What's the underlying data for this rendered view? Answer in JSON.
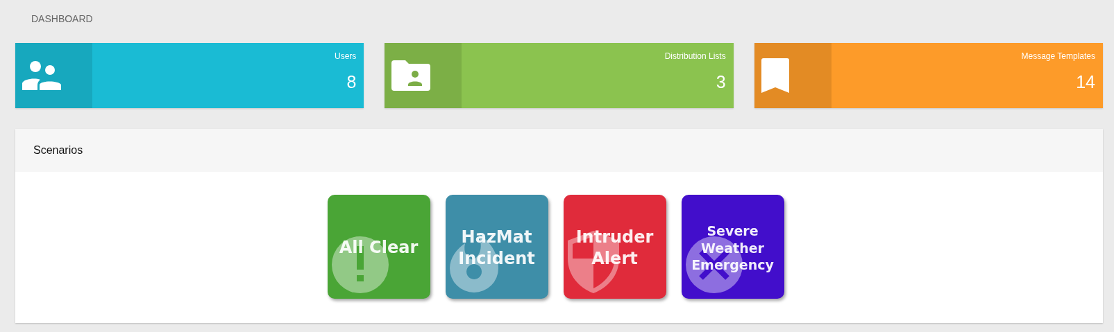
{
  "page_title": "DASHBOARD",
  "stats": [
    {
      "kind": "users",
      "label": "Users",
      "value": "8",
      "color": "#1abbd4"
    },
    {
      "kind": "folder",
      "label": "Distribution Lists",
      "value": "3",
      "color": "#8bc34f"
    },
    {
      "kind": "bookmark",
      "label": "Message Templates",
      "value": "14",
      "color": "#fd9b29"
    }
  ],
  "scenarios": {
    "title": "Scenarios",
    "tiles": [
      {
        "kind": "exclamation",
        "label": "All Clear",
        "color": "#4aa536"
      },
      {
        "kind": "flame",
        "label": "HazMat Incident",
        "color": "#3e8ea8"
      },
      {
        "kind": "shield",
        "label": "Intruder Alert",
        "color": "#e02b3b"
      },
      {
        "kind": "cross",
        "label": "Severe Weather Emergency",
        "color": "#420ecb"
      }
    ]
  }
}
